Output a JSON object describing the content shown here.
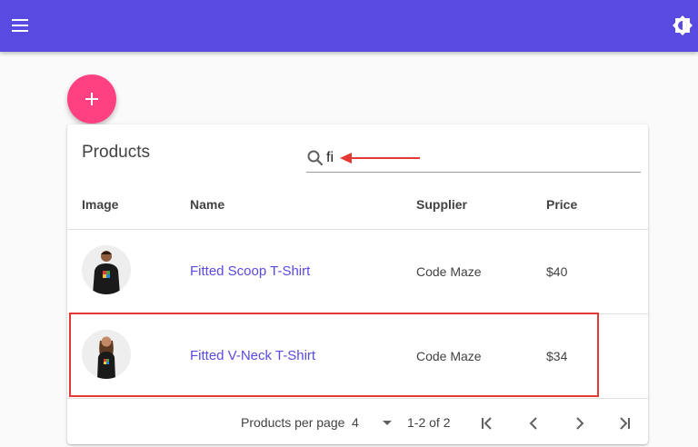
{
  "table": {
    "title": "Products",
    "search": {
      "value": "fi"
    },
    "columns": [
      "Image",
      "Name",
      "Supplier",
      "Price"
    ],
    "rows": [
      {
        "name": "Fitted Scoop T-Shirt",
        "supplier": "Code Maze",
        "price": "$40",
        "image_icon": "man-in-black-hoodie"
      },
      {
        "name": "Fitted V-Neck T-Shirt",
        "supplier": "Code Maze",
        "price": "$34",
        "image_icon": "woman-in-black-tshirt"
      }
    ],
    "footer": {
      "per_page_label": "Products per page",
      "per_page_value": "4",
      "range": "1-2 of 2"
    }
  },
  "colors": {
    "primary": "#594ae2",
    "accent": "#ff4081",
    "annotation": "#e53935"
  }
}
